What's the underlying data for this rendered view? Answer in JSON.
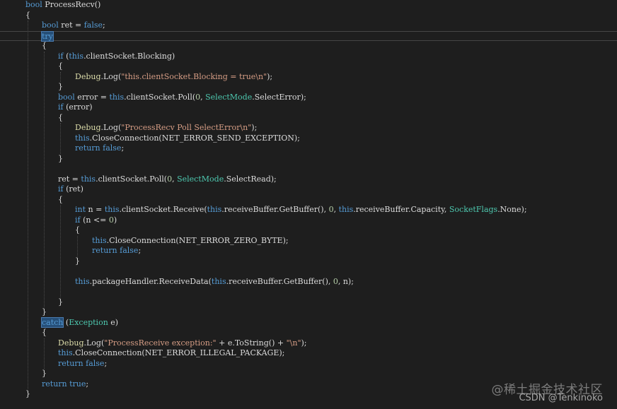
{
  "editor": {
    "lines": [
      [
        {
          "t": "bool",
          "c": "kw"
        },
        {
          "t": " ProcessRecv()",
          "c": "plain"
        }
      ],
      [
        {
          "t": "{",
          "c": "plain"
        }
      ],
      [
        {
          "t": "bool",
          "c": "kw"
        },
        {
          "t": " ret = ",
          "c": "plain"
        },
        {
          "t": "false",
          "c": "kw"
        },
        {
          "t": ";",
          "c": "plain"
        }
      ],
      [
        {
          "t": "try",
          "c": "kw hl"
        }
      ],
      [
        {
          "t": "{",
          "c": "plain"
        }
      ],
      [
        {
          "t": "if",
          "c": "kw"
        },
        {
          "t": " (",
          "c": "plain"
        },
        {
          "t": "this",
          "c": "kw"
        },
        {
          "t": ".clientSocket.Blocking)",
          "c": "plain"
        }
      ],
      [
        {
          "t": "{",
          "c": "plain"
        }
      ],
      [
        {
          "t": "Debug",
          "c": "fn"
        },
        {
          "t": ".Log(",
          "c": "plain"
        },
        {
          "t": "\"this.clientSocket.Blocking = true\\n\"",
          "c": "str"
        },
        {
          "t": ");",
          "c": "plain"
        }
      ],
      [
        {
          "t": "}",
          "c": "plain"
        }
      ],
      [
        {
          "t": "bool",
          "c": "kw"
        },
        {
          "t": " error = ",
          "c": "plain"
        },
        {
          "t": "this",
          "c": "kw"
        },
        {
          "t": ".clientSocket.Poll(",
          "c": "plain"
        },
        {
          "t": "0",
          "c": "num"
        },
        {
          "t": ", ",
          "c": "plain"
        },
        {
          "t": "SelectMode",
          "c": "type"
        },
        {
          "t": ".SelectError);",
          "c": "plain"
        }
      ],
      [
        {
          "t": "if",
          "c": "kw"
        },
        {
          "t": " (error)",
          "c": "plain"
        }
      ],
      [
        {
          "t": "{",
          "c": "plain"
        }
      ],
      [
        {
          "t": "Debug",
          "c": "fn"
        },
        {
          "t": ".Log(",
          "c": "plain"
        },
        {
          "t": "\"ProcessRecv Poll SelectError\\n\"",
          "c": "str"
        },
        {
          "t": ");",
          "c": "plain"
        }
      ],
      [
        {
          "t": "this",
          "c": "kw"
        },
        {
          "t": ".CloseConnection(NET_ERROR_SEND_EXCEPTION);",
          "c": "plain"
        }
      ],
      [
        {
          "t": "return",
          "c": "kw"
        },
        {
          "t": " ",
          "c": "plain"
        },
        {
          "t": "false",
          "c": "kw"
        },
        {
          "t": ";",
          "c": "plain"
        }
      ],
      [
        {
          "t": "}",
          "c": "plain"
        }
      ],
      [],
      [
        {
          "t": "ret = ",
          "c": "plain"
        },
        {
          "t": "this",
          "c": "kw"
        },
        {
          "t": ".clientSocket.Poll(",
          "c": "plain"
        },
        {
          "t": "0",
          "c": "num"
        },
        {
          "t": ", ",
          "c": "plain"
        },
        {
          "t": "SelectMode",
          "c": "type"
        },
        {
          "t": ".SelectRead);",
          "c": "plain"
        }
      ],
      [
        {
          "t": "if",
          "c": "kw"
        },
        {
          "t": " (ret)",
          "c": "plain"
        }
      ],
      [
        {
          "t": "{",
          "c": "plain"
        }
      ],
      [
        {
          "t": "int",
          "c": "kw"
        },
        {
          "t": " n = ",
          "c": "plain"
        },
        {
          "t": "this",
          "c": "kw"
        },
        {
          "t": ".clientSocket.Receive(",
          "c": "plain"
        },
        {
          "t": "this",
          "c": "kw"
        },
        {
          "t": ".receiveBuffer.GetBuffer(), ",
          "c": "plain"
        },
        {
          "t": "0",
          "c": "num"
        },
        {
          "t": ", ",
          "c": "plain"
        },
        {
          "t": "this",
          "c": "kw"
        },
        {
          "t": ".receiveBuffer.Capacity, ",
          "c": "plain"
        },
        {
          "t": "SocketFlags",
          "c": "type"
        },
        {
          "t": ".None);",
          "c": "plain"
        }
      ],
      [
        {
          "t": "if",
          "c": "kw"
        },
        {
          "t": " (n <= ",
          "c": "plain"
        },
        {
          "t": "0",
          "c": "num"
        },
        {
          "t": ")",
          "c": "plain"
        }
      ],
      [
        {
          "t": "{",
          "c": "plain"
        }
      ],
      [
        {
          "t": "this",
          "c": "kw"
        },
        {
          "t": ".CloseConnection(NET_ERROR_ZERO_BYTE);",
          "c": "plain"
        }
      ],
      [
        {
          "t": "return",
          "c": "kw"
        },
        {
          "t": " ",
          "c": "plain"
        },
        {
          "t": "false",
          "c": "kw"
        },
        {
          "t": ";",
          "c": "plain"
        }
      ],
      [
        {
          "t": "}",
          "c": "plain"
        }
      ],
      [],
      [
        {
          "t": "this",
          "c": "kw"
        },
        {
          "t": ".packageHandler.ReceiveData(",
          "c": "plain"
        },
        {
          "t": "this",
          "c": "kw"
        },
        {
          "t": ".receiveBuffer.GetBuffer(), ",
          "c": "plain"
        },
        {
          "t": "0",
          "c": "num"
        },
        {
          "t": ", n);",
          "c": "plain"
        }
      ],
      [],
      [
        {
          "t": "}",
          "c": "plain"
        }
      ],
      [
        {
          "t": "}",
          "c": "plain"
        }
      ],
      [
        {
          "t": "catch",
          "c": "kw hl"
        },
        {
          "t": " (",
          "c": "plain"
        },
        {
          "t": "Exception",
          "c": "type"
        },
        {
          "t": " e)",
          "c": "plain"
        }
      ],
      [
        {
          "t": "{",
          "c": "plain"
        }
      ],
      [
        {
          "t": "Debug",
          "c": "fn"
        },
        {
          "t": ".Log(",
          "c": "plain"
        },
        {
          "t": "\"ProcessReceive exception:\"",
          "c": "str"
        },
        {
          "t": " + e.ToString() + ",
          "c": "plain"
        },
        {
          "t": "\"\\n\"",
          "c": "str"
        },
        {
          "t": ");",
          "c": "plain"
        }
      ],
      [
        {
          "t": "this",
          "c": "kw"
        },
        {
          "t": ".CloseConnection(NET_ERROR_ILLEGAL_PACKAGE);",
          "c": "plain"
        }
      ],
      [
        {
          "t": "return",
          "c": "kw"
        },
        {
          "t": " ",
          "c": "plain"
        },
        {
          "t": "false",
          "c": "kw"
        },
        {
          "t": ";",
          "c": "plain"
        }
      ],
      [
        {
          "t": "}",
          "c": "plain"
        }
      ],
      [
        {
          "t": "return",
          "c": "kw"
        },
        {
          "t": " ",
          "c": "plain"
        },
        {
          "t": "true",
          "c": "kw"
        },
        {
          "t": ";",
          "c": "plain"
        }
      ],
      [
        {
          "t": "}",
          "c": "plain"
        }
      ]
    ]
  },
  "watermark": {
    "site": "@稀土掘金技术社区",
    "author": "CSDN @Tenkinoko"
  },
  "colors": {
    "background": "#1e1e1e",
    "keyword": "#569cd6",
    "string": "#d69d85",
    "type": "#4ec9b0",
    "number": "#b5cea8",
    "method": "#dcdcaa",
    "text": "#dcdcdc",
    "highlight": "#264f78"
  }
}
